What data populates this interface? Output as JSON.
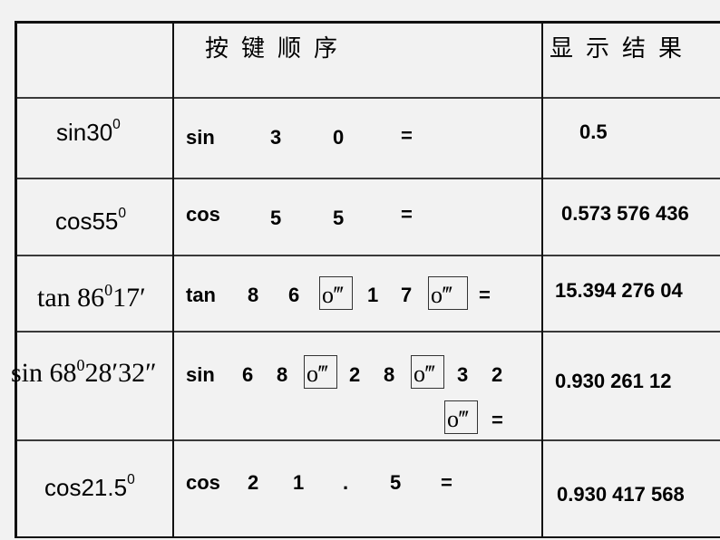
{
  "header": {
    "col1": "",
    "col2": "按键顺序",
    "col3": "显示结果"
  },
  "rows": [
    {
      "expr": {
        "fn": "sin",
        "value": "30",
        "sup": "0"
      },
      "keys": [
        "sin",
        "3",
        "0",
        "="
      ],
      "result": "0.5"
    },
    {
      "expr": {
        "fn": "cos",
        "value": "55",
        "sup": "0"
      },
      "keys": [
        "cos",
        "5",
        "5",
        "="
      ],
      "result": "0.573 576 436"
    },
    {
      "expr": {
        "fn": "tan",
        "deg": "86",
        "sup": "0",
        "min": "17′"
      },
      "keys": [
        "tan",
        "8",
        "6",
        "o‴",
        "1",
        "7",
        "o‴",
        "="
      ],
      "result": "15.394 276  04"
    },
    {
      "expr": {
        "fn": "sin",
        "deg": "68",
        "sup": "0",
        "min": "28′32″"
      },
      "keys": [
        "sin",
        "6",
        "8",
        "o‴",
        "2",
        "8",
        "o‴",
        "3",
        "2",
        "o‴",
        "="
      ],
      "result": "0.930 261 12"
    },
    {
      "expr": {
        "fn": "cos",
        "value": "21.5",
        "sup": "0"
      },
      "keys": [
        "cos",
        "2",
        "1",
        ".",
        "5",
        "="
      ],
      "result": "0.930 417 568"
    }
  ]
}
